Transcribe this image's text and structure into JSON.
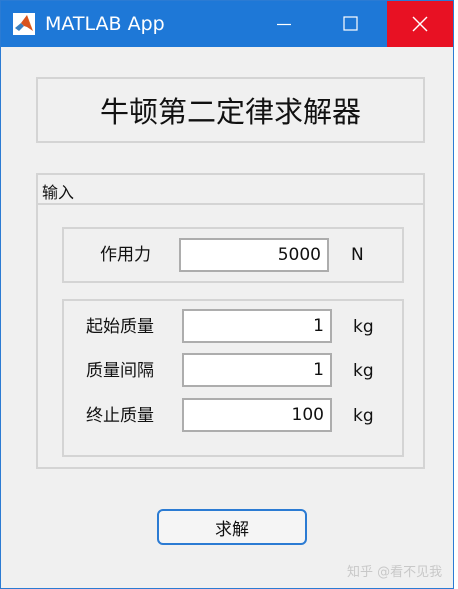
{
  "window": {
    "title": "MATLAB App"
  },
  "header": {
    "title": "牛顿第二定律求解器"
  },
  "input_panel": {
    "title": "输入",
    "force": {
      "label": "作用力",
      "value": "5000",
      "unit": "N"
    },
    "start_mass": {
      "label": "起始质量",
      "value": "1",
      "unit": "kg"
    },
    "mass_step": {
      "label": "质量间隔",
      "value": "1",
      "unit": "kg"
    },
    "end_mass": {
      "label": "终止质量",
      "value": "100",
      "unit": "kg"
    }
  },
  "solve_button": {
    "label": "求解"
  },
  "watermark": "知乎 @看不见我",
  "colors": {
    "titlebar": "#1e78d7",
    "close": "#e81123",
    "background": "#f0f0f0"
  },
  "icons": [
    "matlab-logo-icon",
    "minimize-icon",
    "maximize-icon",
    "close-icon"
  ]
}
